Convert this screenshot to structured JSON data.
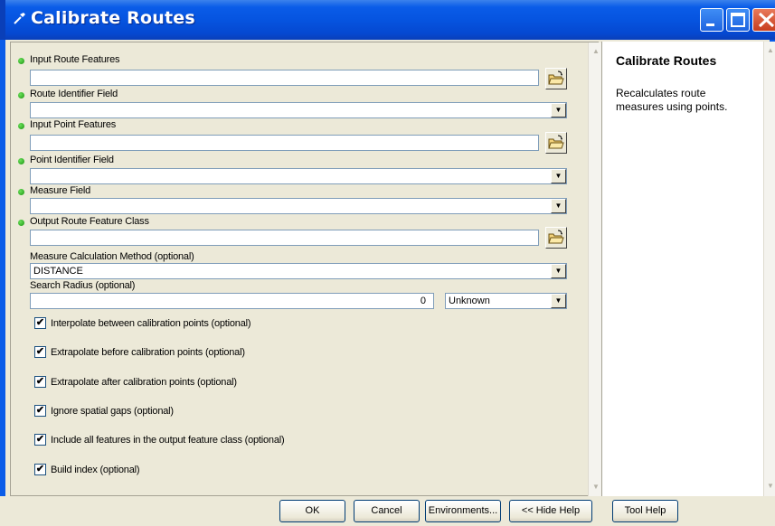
{
  "window": {
    "title": "Calibrate Routes"
  },
  "form": {
    "fields": [
      {
        "label": "Input Route Features",
        "value": "",
        "required": true,
        "kind": "text-browse"
      },
      {
        "label": "Route Identifier Field",
        "value": "",
        "required": true,
        "kind": "combo"
      },
      {
        "label": "Input Point Features",
        "value": "",
        "required": true,
        "kind": "text-browse"
      },
      {
        "label": "Point Identifier Field",
        "value": "",
        "required": true,
        "kind": "combo"
      },
      {
        "label": "Measure Field",
        "value": "",
        "required": true,
        "kind": "combo"
      },
      {
        "label": "Output Route Feature Class",
        "value": "",
        "required": true,
        "kind": "text-browse"
      },
      {
        "label": "Measure Calculation Method (optional)",
        "value": "DISTANCE",
        "required": false,
        "kind": "combo"
      },
      {
        "label": "Search Radius (optional)",
        "value": "0",
        "unit": "Unknown",
        "required": false,
        "kind": "number-unit"
      }
    ],
    "checkboxes": [
      {
        "label": "Interpolate between calibration points (optional)",
        "checked": true
      },
      {
        "label": "Extrapolate before calibration points (optional)",
        "checked": true
      },
      {
        "label": "Extrapolate after calibration points (optional)",
        "checked": true
      },
      {
        "label": "Ignore spatial gaps (optional)",
        "checked": true
      },
      {
        "label": "Include all features in the output feature class (optional)",
        "checked": true
      },
      {
        "label": "Build index (optional)",
        "checked": true
      }
    ],
    "check_mark": "✔"
  },
  "help": {
    "title": "Calibrate Routes",
    "text": "Recalculates route measures using points."
  },
  "buttons": {
    "ok": "OK",
    "cancel": "Cancel",
    "environments": "Environments...",
    "hide_help": "<< Hide Help",
    "tool_help": "Tool Help"
  },
  "colors": {
    "title_blue": "#0a5ce8",
    "required_dot": "#1a9410",
    "window_bg": "#ece9d8"
  }
}
